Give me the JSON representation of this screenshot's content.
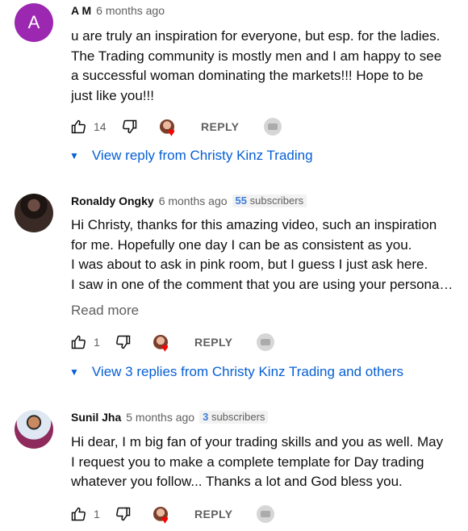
{
  "comments": [
    {
      "avatar_letter": "A",
      "author": "A M",
      "time": "6 months ago",
      "subs_count": "",
      "subs_label": "",
      "lines": [
        "u are truly an inspiration for everyone, but esp. for the ladies.",
        "The Trading community is mostly men and I am happy to see",
        "a successful woman dominating the markets!!! Hope to be",
        "just like you!!!"
      ],
      "likes": "14",
      "reply_label": "REPLY",
      "replies_link": "View reply from Christy Kinz Trading"
    },
    {
      "author": "Ronaldy Ongky",
      "time": "6 months ago",
      "subs_count": "55",
      "subs_label": "subscribers",
      "lines": [
        "Hi Christy, thanks for this amazing video, such an inspiration",
        "for me. Hopefully one day I can be as consistent as you.",
        "I was about to ask in pink room, but I guess I just ask here.",
        "I saw in one of the comment that you are using your persona…"
      ],
      "read_more": "Read more",
      "likes": "1",
      "reply_label": "REPLY",
      "replies_link": "View 3 replies from Christy Kinz Trading and others"
    },
    {
      "author": "Sunil Jha",
      "time": "5 months ago",
      "subs_count": "3",
      "subs_label": "subscribers",
      "lines": [
        "Hi dear, I m big fan of your trading skills and you as well. May",
        "I request you to make a complete template for Day trading",
        "whatever you follow... Thanks a lot and God bless you."
      ],
      "likes": "1",
      "reply_label": "REPLY"
    }
  ],
  "colors": {
    "link": "#065fd4",
    "heart": "#ff0000",
    "avatar_a": "#9c27b0"
  },
  "icons": [
    "thumb-up-icon",
    "thumb-down-icon",
    "creator-heart-icon",
    "thanks-icon",
    "caret-down-icon"
  ]
}
